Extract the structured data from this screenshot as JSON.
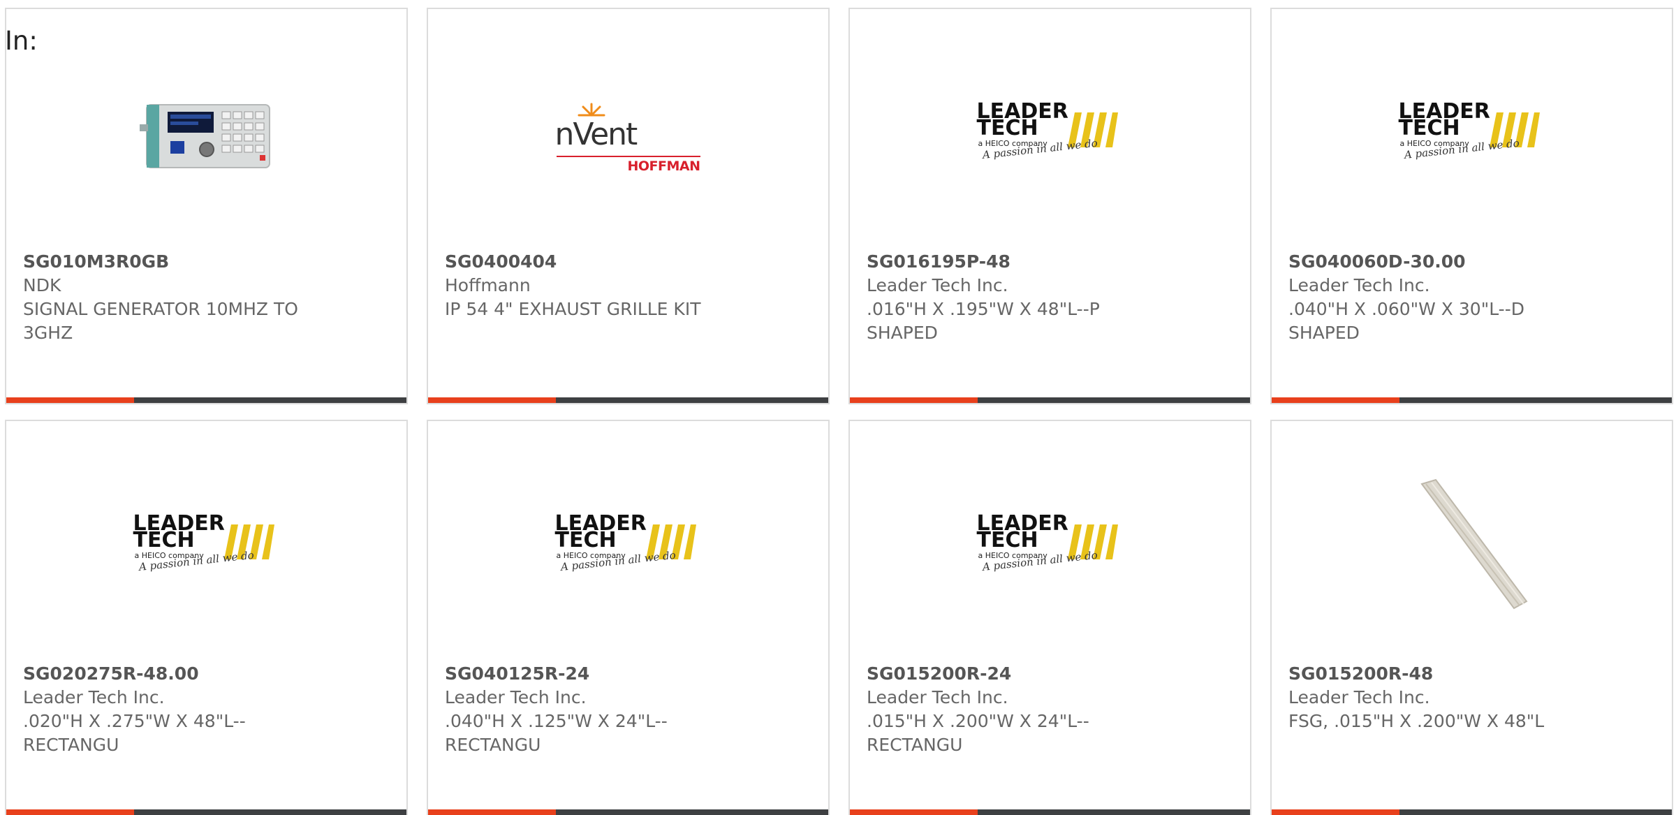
{
  "filter": {
    "label": "In:"
  },
  "products": [
    {
      "part_number": "SG010M3R0GB",
      "manufacturer": "NDK",
      "description": "SIGNAL GENERATOR 10MHZ TO 3GHZ",
      "image": "signal-generator-image"
    },
    {
      "part_number": "SG0400404",
      "manufacturer": "Hoffmann",
      "description": "IP 54 4\" EXHAUST GRILLE KIT",
      "image": "nvent-hoffman-logo",
      "logo": {
        "word": "nVent",
        "sub": "HOFFMAN"
      }
    },
    {
      "part_number": "SG016195P-48",
      "manufacturer": "Leader Tech Inc.",
      "description": ".016\"H X .195\"W X 48\"L--P SHAPED",
      "image": "leader-tech-logo"
    },
    {
      "part_number": "SG040060D-30.00",
      "manufacturer": "Leader Tech Inc.",
      "description": ".040\"H X .060\"W X 30\"L--D SHAPED",
      "image": "leader-tech-logo"
    },
    {
      "part_number": "SG020275R-48.00",
      "manufacturer": "Leader Tech Inc.",
      "description": ".020\"H X .275\"W X 48\"L--RECTANGU",
      "image": "leader-tech-logo"
    },
    {
      "part_number": "SG040125R-24",
      "manufacturer": "Leader Tech Inc.",
      "description": ".040\"H X .125\"W X 24\"L--RECTANGU",
      "image": "leader-tech-logo"
    },
    {
      "part_number": "SG015200R-24",
      "manufacturer": "Leader Tech Inc.",
      "description": ".015\"H X .200\"W X 24\"L--RECTANGU",
      "image": "leader-tech-logo"
    },
    {
      "part_number": "SG015200R-48",
      "manufacturer": "Leader Tech Inc.",
      "description": "FSG, .015\"H X .200\"W X 48\"L",
      "image": "gasket-strip-image"
    }
  ],
  "leader_tech_logo": {
    "line1": "LEADER",
    "line2": "TECH",
    "company": "a HEICO company",
    "tagline": "A passion in all we do"
  },
  "colors": {
    "accent": "#e8401c",
    "bar": "#3e4042",
    "logo_yellow": "#e8c21a",
    "hoffman_red": "#d8202c"
  }
}
